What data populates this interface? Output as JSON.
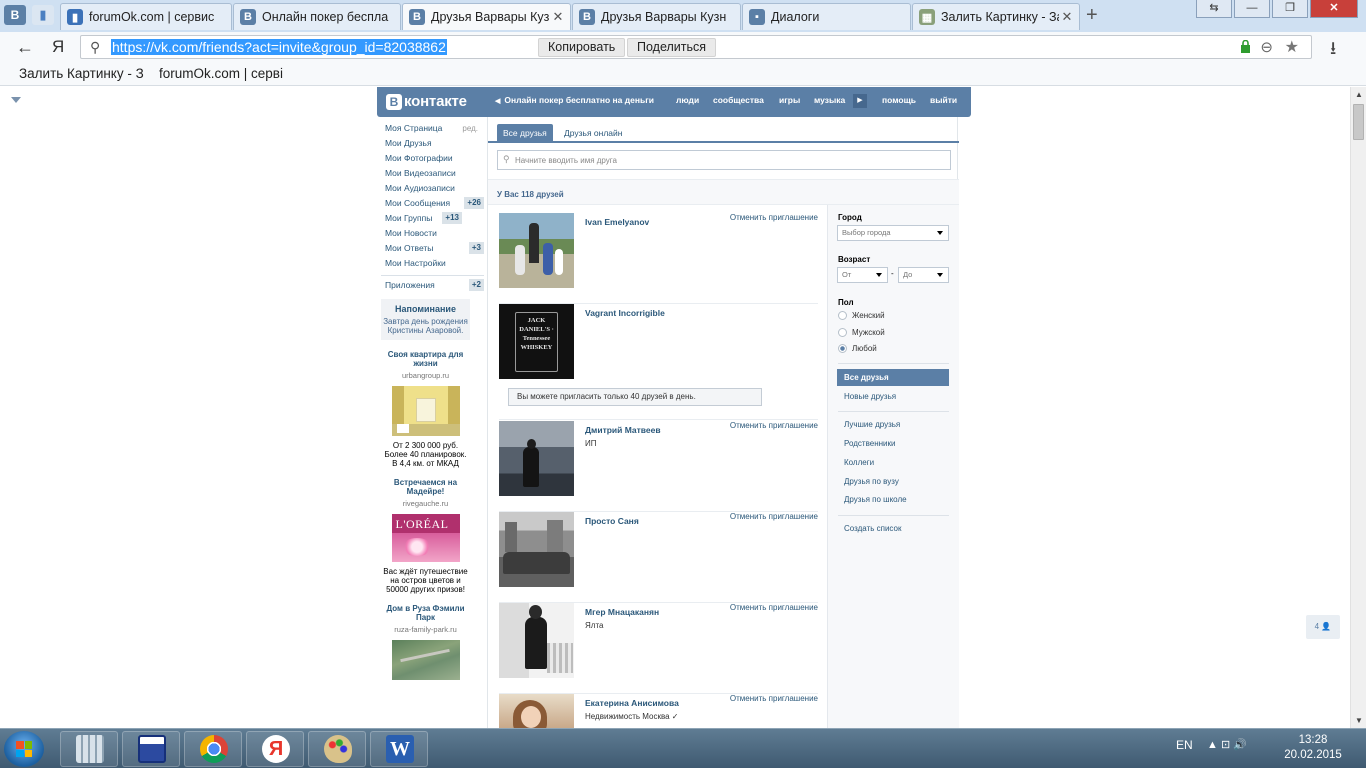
{
  "browser": {
    "pinned": [
      {
        "icon": "vk-icon",
        "glyph": "B",
        "color": "#5b7fa6"
      },
      {
        "icon": "bookmark-book-icon",
        "glyph": "▮",
        "color": "#4a7fc1"
      }
    ],
    "tabs": [
      {
        "title": "forumOk.com | сервис",
        "icon": "forum-icon",
        "glyph": "▮",
        "color": "#3c72b8",
        "active": false
      },
      {
        "title": "Онлайн покер беспла",
        "icon": "vk-icon",
        "glyph": "B",
        "color": "#5b7fa6",
        "active": false
      },
      {
        "title": "Друзья Варвары Кузн",
        "icon": "vk-icon",
        "glyph": "B",
        "color": "#5b7fa6",
        "active": true
      },
      {
        "title": "Друзья Варвары Кузн",
        "icon": "vk-icon",
        "glyph": "B",
        "color": "#5b7fa6",
        "active": false
      },
      {
        "title": "Диалоги",
        "icon": "dialogs-icon",
        "glyph": "▪",
        "color": "#5b7fa6",
        "active": false
      },
      {
        "title": "Залить Картинку - Зал",
        "icon": "image-icon",
        "glyph": "▦",
        "color": "#8aa07a",
        "active": false
      }
    ],
    "close_glyph": "✕",
    "new_tab_glyph": "+",
    "window_buttons": {
      "swap": "⇆",
      "minimize": "—",
      "maximize": "❐",
      "close": "✕"
    },
    "back_glyph": "←",
    "yandex_glyph": "Я",
    "url": "https://vk.com/friends?act=invite&group_id=82038862",
    "copy_button": "Копировать",
    "share_button": "Поделиться",
    "bookmarks": [
      "Залить Картинку - З",
      "forumOk.com | серві"
    ]
  },
  "vk": {
    "logo_b": "B",
    "logo_text": "контакте",
    "header_link": "Онлайн покер бесплатно на деньги",
    "nav": [
      "люди",
      "сообщества",
      "игры",
      "музыка",
      "помощь",
      "выйти"
    ],
    "menu": [
      {
        "label": "Моя Страница",
        "edit": "ред."
      },
      {
        "label": "Мои Друзья"
      },
      {
        "label": "Мои Фотографии"
      },
      {
        "label": "Мои Видеозаписи"
      },
      {
        "label": "Мои Аудиозаписи"
      },
      {
        "label": "Мои Сообщения",
        "count": "+26"
      },
      {
        "label": "Мои Группы",
        "count": "+13"
      },
      {
        "label": "Мои Новости"
      },
      {
        "label": "Мои Ответы",
        "count": "+3"
      },
      {
        "label": "Мои Настройки"
      }
    ],
    "apps": {
      "label": "Приложения",
      "count": "+2"
    },
    "reminder": {
      "title": "Напоминание",
      "text": "Завтра день рождения Кристины Азаровой."
    },
    "ads": [
      {
        "title": "Своя квартира для жизни",
        "domain": "urbangroup.ru",
        "text": "От 2 300 000 руб. Более 40 планировок. В 4,4 км. от МКАД",
        "image": "room-photo",
        "logo_text": ""
      },
      {
        "title": "Встречаемся на Мадейре!",
        "domain": "rivegauche.ru",
        "text": "Вас ждёт путешествие на остров цветов и 50000 других призов!",
        "image": "loreal-photo",
        "logo_text": "L'ORÉAL"
      },
      {
        "title": "Дом в Руза Фэмили Парк",
        "domain": "ruza-family-park.ru",
        "text": "",
        "image": "aerial-photo",
        "logo_text": ""
      }
    ],
    "tabs": {
      "all": "Все друзья",
      "online": "Друзья онлайн"
    },
    "search_placeholder": "Начните вводить имя друга",
    "summary": "У Вас 118 друзей",
    "friends": [
      {
        "name": "Ivan Emelyanov",
        "sub": "",
        "action": "Отменить приглашение",
        "photo": "family-photo"
      },
      {
        "name": "Vagrant Incorrigible",
        "sub": "",
        "action": "",
        "photo": "jackdaniels-photo",
        "photo_text": "JACK DANIEL'S · Tennessee WHISKEY"
      },
      {
        "name": "Дмитрий Матвеев",
        "sub": "ИП",
        "action": "Отменить приглашение",
        "photo": "sea-photo"
      },
      {
        "name": "Просто Саня",
        "sub": "",
        "action": "Отменить приглашение",
        "photo": "car-photo"
      },
      {
        "name": "Мгер Мнацаканян",
        "sub": "Ялта",
        "action": "Отменить приглашение",
        "photo": "snow-photo"
      },
      {
        "name": "Екатерина Анисимова",
        "sub": "Недвижимость Москва ✓",
        "action": "Отменить приглашение",
        "photo": "woman-photo"
      }
    ],
    "notice": "Вы можете пригласить только 40 друзей в день.",
    "filters": {
      "city_label": "Город",
      "city_value": "Выбор города",
      "age_label": "Возраст",
      "age_from": "От",
      "age_dash": "-",
      "age_to": "До",
      "sex_label": "Пол",
      "sex_options": [
        {
          "label": "Женский",
          "selected": false
        },
        {
          "label": "Мужской",
          "selected": false
        },
        {
          "label": "Любой",
          "selected": true
        }
      ]
    },
    "lists": {
      "primary": [
        {
          "label": "Все друзья",
          "selected": true
        },
        {
          "label": "Новые друзья",
          "selected": false
        }
      ],
      "groups": [
        "Лучшие друзья",
        "Родственники",
        "Коллеги",
        "Друзья по вузу",
        "Друзья по школе"
      ],
      "create": "Создать список"
    },
    "chat_badge": "4 👤"
  },
  "taskbar": {
    "apps": [
      {
        "name": "calculator",
        "color": "#6e8aa0"
      },
      {
        "name": "save-disk",
        "color": "#2c4aa0"
      },
      {
        "name": "chrome",
        "color": "#dd4433"
      },
      {
        "name": "yandex-browser",
        "color": "#e8362c"
      },
      {
        "name": "paint",
        "color": "#c7a85a"
      },
      {
        "name": "word",
        "color": "#2a5fb0"
      }
    ],
    "word_glyph": "W",
    "lang": "EN",
    "tray_glyphs": "▲  ⊡  🔊",
    "time": "13:28",
    "date": "20.02.2015"
  }
}
